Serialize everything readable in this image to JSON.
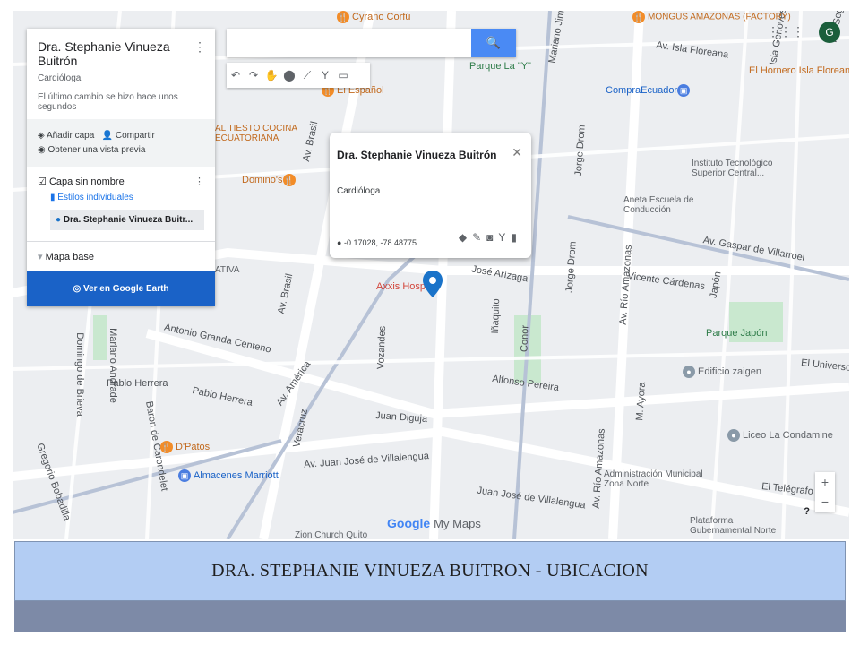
{
  "panel": {
    "title": "Dra. Stephanie Vinueza Buitrón",
    "subtitle": "Cardióloga",
    "saved_status": "El último cambio se hizo hace unos segundos",
    "add_layer": "Añadir capa",
    "share": "Compartir",
    "preview": "Obtener una vista previa",
    "layer_name": "Capa sin nombre",
    "styles_link": "Estilos individuales",
    "feature": "Dra. Stephanie Vinueza Buitr...",
    "basemap": "Mapa base",
    "earth_button": "Ver en Google Earth"
  },
  "search": {
    "placeholder": "",
    "value": ""
  },
  "popup": {
    "title": "Dra. Stephanie Vinueza Buitrón",
    "description": "Cardióloga",
    "coords": "-0.17028, -78.48775"
  },
  "account": {
    "initial": "G"
  },
  "map_labels": {
    "streets": [
      "Av. Isla Floreana",
      "Av. Gaspar de Villarroel",
      "Vicente Cárdenas",
      "Japón",
      "José Arízaga",
      "Antonio Granda Centeno",
      "Pablo Herrera",
      "Pablo Herrera",
      "Juan Diguja",
      "Av. Juan José de Villalengua",
      "Juan José de Villalengua",
      "Alfonso Pereira",
      "Av. Brasil",
      "Av. Brasil",
      "Av. América",
      "Veracruz",
      "Vozandes",
      "Iñaquito",
      "Conor",
      "Jorge Drom",
      "Jorge Drom",
      "Av. Río Amazonas",
      "Av. Río Amazonas",
      "M. Ayora",
      "Mariano Andrade",
      "Domingo de Brieva",
      "Baron de Carondelet",
      "Gregorio Bobadilla",
      "El Telégrafo",
      "El Universo",
      "Mariano Jimb",
      "Isla Genovesa",
      "Isla Seg"
    ],
    "pois": [
      "Cyrano Corfú",
      "MONGUS AMAZONAS (FACTORY)",
      "Parque La \"Y\"",
      "El Español",
      "El Hornero Isla Floreana",
      "CompraEcuador",
      "AL TIESTO COCINA ECUATORIANA",
      "Domino's",
      "Instituto Tecnológico Superior Central...",
      "Aneta Escuela de Conducción",
      "Axxis Hospital",
      "Parque Japón",
      "Edificio zaigen",
      "Liceo La Condamine",
      "Administración Municipal Zona Norte",
      "Plataforma Gubernamental Norte",
      "D'Patos",
      "Almacenes Marriott",
      "Zion Church Quito",
      "ATIVA"
    ]
  },
  "branding": {
    "google": "Google",
    "mymaps": "My Maps"
  },
  "zoom": {
    "in": "+",
    "out": "−"
  },
  "slide_title": "DRA. STEPHANIE  VINUEZA  BUITRON  -  UBICACION",
  "colors": {
    "title_band": "#b3cdf3",
    "bottom_bar": "#7d8aa7",
    "accent": "#1a62c7",
    "search_button": "#4a8af4"
  }
}
